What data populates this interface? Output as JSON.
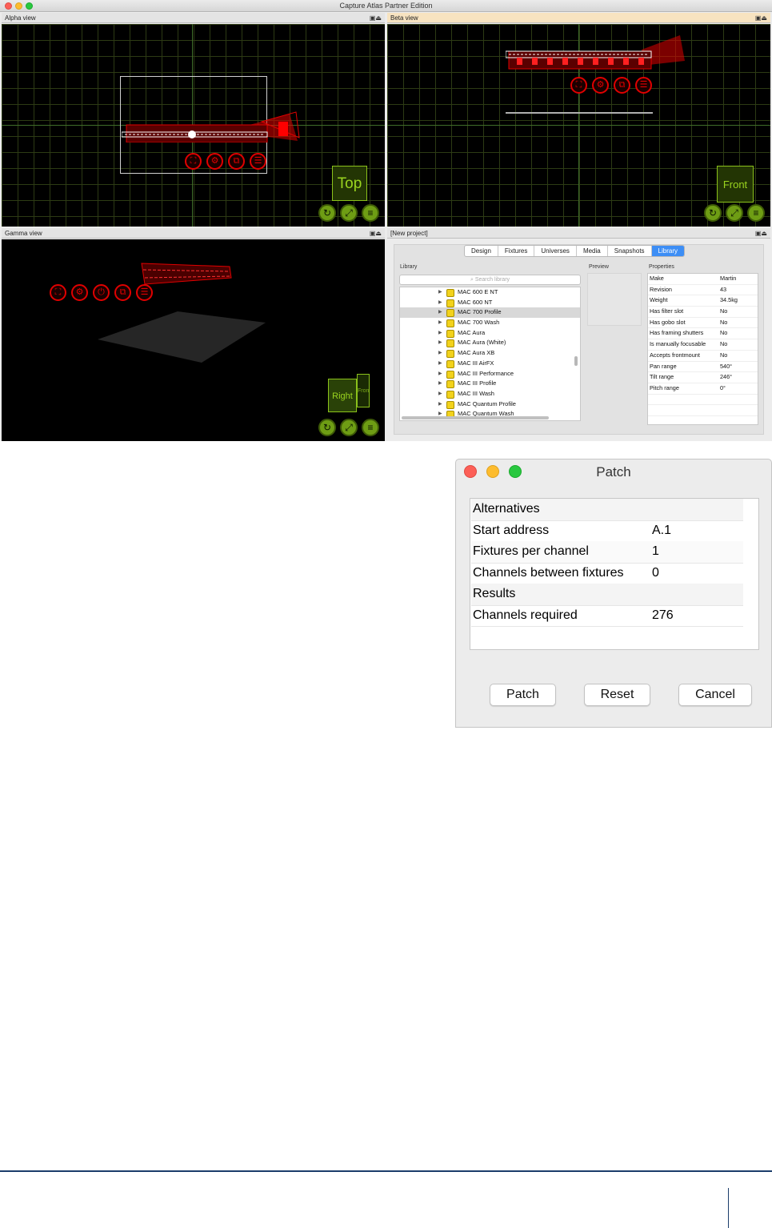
{
  "window": {
    "title": "Capture Atlas Partner Edition"
  },
  "views": {
    "alpha": {
      "title": "Alpha view",
      "cube_label": "Top"
    },
    "beta": {
      "title": "Beta view",
      "cube_label": "Front"
    },
    "gamma": {
      "title": "Gamma view",
      "cube_label_front": "Right",
      "cube_label_side": "Front"
    },
    "project": {
      "title": "[New project]"
    }
  },
  "tabs": [
    {
      "label": "Design",
      "active": false
    },
    {
      "label": "Fixtures",
      "active": false
    },
    {
      "label": "Universes",
      "active": false
    },
    {
      "label": "Media",
      "active": false
    },
    {
      "label": "Snapshots",
      "active": false
    },
    {
      "label": "Library",
      "active": true
    }
  ],
  "library": {
    "label": "Library",
    "search_placeholder": "Search library",
    "items": [
      "MAC 600 E NT",
      "MAC 600 NT",
      "MAC 700 Profile",
      "MAC 700 Wash",
      "MAC Aura",
      "MAC Aura (White)",
      "MAC Aura XB",
      "MAC III AirFX",
      "MAC III Performance",
      "MAC III Profile",
      "MAC III Wash",
      "MAC Quantum Profile",
      "MAC Quantum Wash"
    ],
    "selected": "MAC 700 Profile"
  },
  "preview": {
    "label": "Preview"
  },
  "properties": {
    "label": "Properties",
    "rows": [
      {
        "key": "Make",
        "value": "Martin"
      },
      {
        "key": "Revision",
        "value": "43"
      },
      {
        "key": "Weight",
        "value": "34.5kg"
      },
      {
        "key": "Has filter slot",
        "value": "No"
      },
      {
        "key": "Has gobo slot",
        "value": "No"
      },
      {
        "key": "Has framing shutters",
        "value": "No"
      },
      {
        "key": "Is manually focusable",
        "value": "No"
      },
      {
        "key": "Accepts frontmount",
        "value": "No"
      },
      {
        "key": "Pan range",
        "value": "540°"
      },
      {
        "key": "Tilt range",
        "value": "246°"
      },
      {
        "key": "Pitch range",
        "value": "0°"
      }
    ]
  },
  "patch_dialog": {
    "title": "Patch",
    "rows": [
      {
        "key": "Alternatives",
        "value": "",
        "header": true
      },
      {
        "key": "Start address",
        "value": "A.1",
        "header": false
      },
      {
        "key": "Fixtures per channel",
        "value": "1",
        "header": false
      },
      {
        "key": "Channels between fixtures",
        "value": "0",
        "header": false
      },
      {
        "key": "Results",
        "value": "",
        "header": true
      },
      {
        "key": "Channels required",
        "value": "276",
        "header": false
      }
    ],
    "buttons": {
      "patch": "Patch",
      "reset": "Reset",
      "cancel": "Cancel"
    }
  },
  "colors": {
    "grid": "#2d3b14",
    "accent_green": "#8bc21b",
    "fixture_red": "#e00000",
    "selection_blue": "#3d8ef5"
  }
}
